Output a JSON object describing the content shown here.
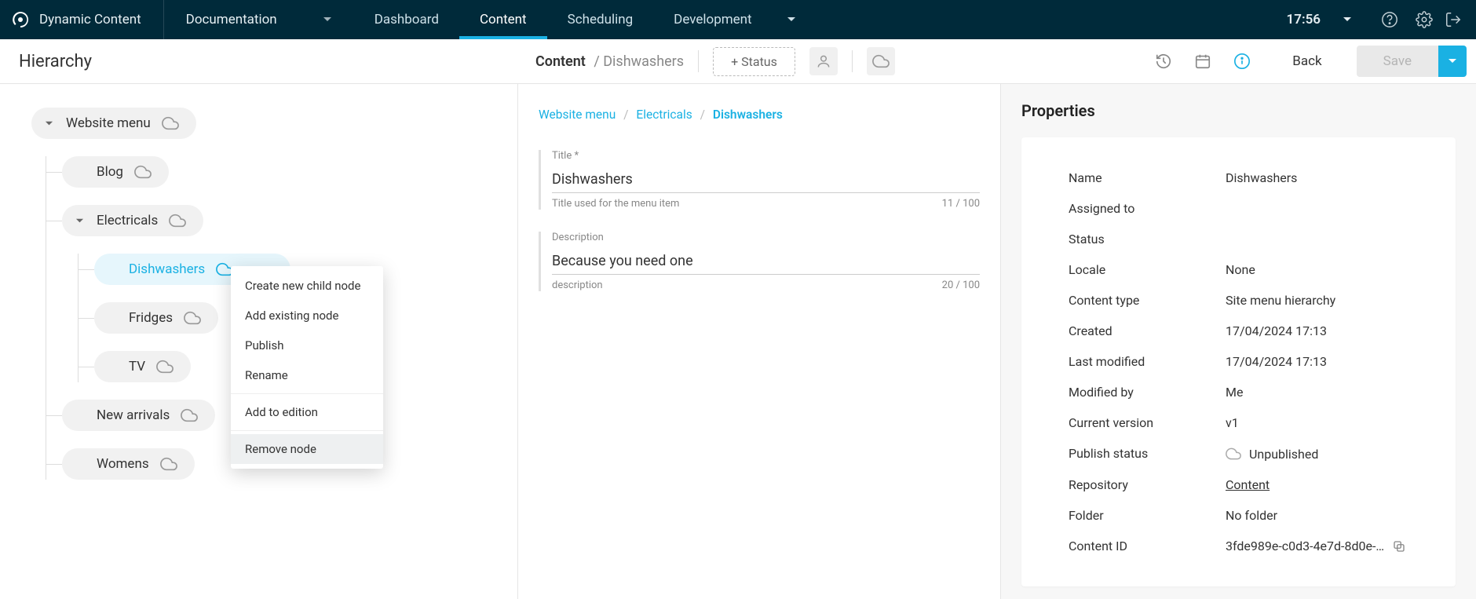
{
  "topbar": {
    "brand": "Dynamic Content",
    "docs_label": "Documentation",
    "nav": {
      "dashboard": "Dashboard",
      "content": "Content",
      "scheduling": "Scheduling",
      "development": "Development"
    },
    "time": "17:56"
  },
  "row2": {
    "hierarchy_title": "Hierarchy",
    "crumb_root": "Content",
    "crumb_sub": "/ Dishwashers",
    "status_btn": "+ Status",
    "back": "Back",
    "save": "Save"
  },
  "tree": {
    "root": "Website menu",
    "items": [
      {
        "label": "Blog"
      },
      {
        "label": "Electricals",
        "children": [
          {
            "label": "Dishwashers",
            "active": true
          },
          {
            "label": "Fridges"
          },
          {
            "label": "TV"
          }
        ]
      },
      {
        "label": "New arrivals"
      },
      {
        "label": "Womens"
      }
    ]
  },
  "context_menu": {
    "items": [
      "Create new child node",
      "Add existing node",
      "Publish",
      "Rename",
      "Add to edition",
      "Remove node"
    ]
  },
  "editor": {
    "breadcrumb": {
      "root": "Website menu",
      "mid": "Electricals",
      "leaf": "Dishwashers"
    },
    "title_label": "Title *",
    "title_value": "Dishwashers",
    "title_help": "Title used for the menu item",
    "title_count": "11 / 100",
    "desc_label": "Description",
    "desc_value": "Because you need one",
    "desc_help": "description",
    "desc_count": "20 / 100"
  },
  "properties": {
    "header": "Properties",
    "rows": {
      "name": {
        "k": "Name",
        "v": "Dishwashers"
      },
      "assigned": {
        "k": "Assigned to",
        "v": ""
      },
      "status": {
        "k": "Status",
        "v": ""
      },
      "locale": {
        "k": "Locale",
        "v": "None"
      },
      "ctype": {
        "k": "Content type",
        "v": "Site menu hierarchy"
      },
      "created": {
        "k": "Created",
        "v": "17/04/2024 17:13"
      },
      "modified": {
        "k": "Last modified",
        "v": "17/04/2024 17:13"
      },
      "modby": {
        "k": "Modified by",
        "v": "Me"
      },
      "version": {
        "k": "Current version",
        "v": "v1"
      },
      "pubstatus": {
        "k": "Publish status",
        "v": "Unpublished"
      },
      "repo": {
        "k": "Repository",
        "v": "Content"
      },
      "folder": {
        "k": "Folder",
        "v": "No folder"
      },
      "cid": {
        "k": "Content ID",
        "v": "3fde989e-c0d3-4e7d-8d0e-…"
      }
    }
  }
}
